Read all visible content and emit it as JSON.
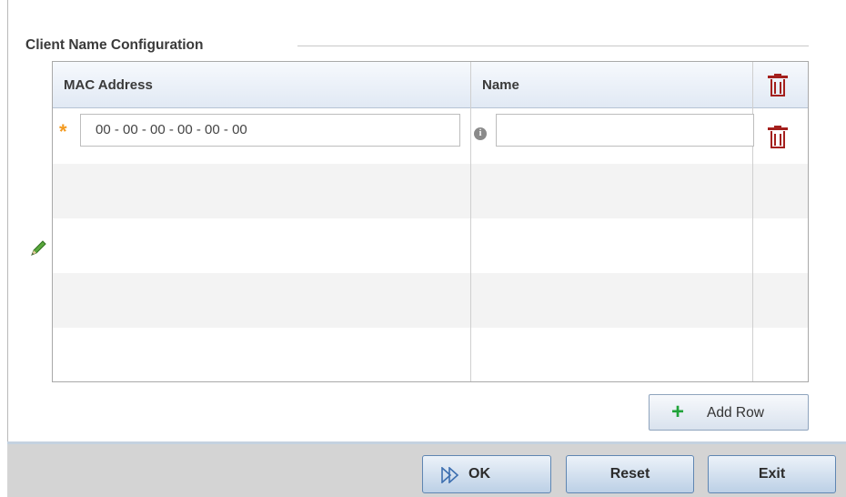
{
  "section": {
    "title": "Client Name Configuration"
  },
  "table": {
    "columns": [
      "MAC Address",
      "Name"
    ],
    "rows": [
      {
        "mac": "00 - 00 - 00 - 00 - 00 - 00",
        "name": ""
      }
    ]
  },
  "buttons": {
    "add_row": "Add Row",
    "ok": "OK",
    "reset": "Reset",
    "exit": "Exit"
  },
  "icons": {
    "delete_all": "trash-icon",
    "delete_row": "trash-icon",
    "required": "asterisk-icon",
    "info": "info-icon",
    "edit": "pencil-icon",
    "add": "plus-icon",
    "ok": "double-arrow-icon"
  },
  "colors": {
    "trash": "#a4201d",
    "required": "#f39a1f",
    "add": "#21a33a",
    "button_border": "#5f86b2"
  }
}
